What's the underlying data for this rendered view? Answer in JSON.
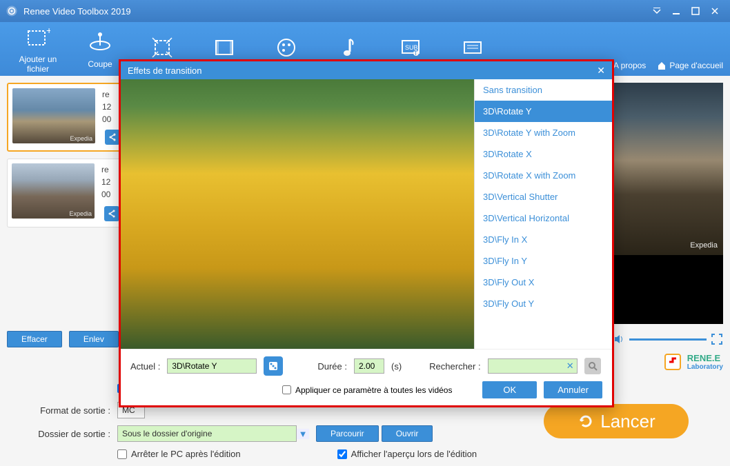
{
  "app": {
    "title": "Renee Video Toolbox 2019"
  },
  "toolbar": {
    "items": [
      {
        "label": "Ajouter un fichier"
      },
      {
        "label": "Coupe"
      },
      {
        "label": ""
      },
      {
        "label": ""
      },
      {
        "label": ""
      },
      {
        "label": ""
      },
      {
        "label": ""
      },
      {
        "label": ""
      }
    ],
    "about": "A propos",
    "home": "Page d'accueil"
  },
  "files": [
    {
      "name_prefix": "re",
      "line2": "12",
      "line3": "00",
      "watermark": "Expedia"
    },
    {
      "name_prefix": "re",
      "line2": "12",
      "line3": "00",
      "watermark": "Expedia"
    }
  ],
  "leftbtns": {
    "effacer": "Effacer",
    "enlever": "Enlev"
  },
  "settings": {
    "format_label": "Format de sortie :",
    "format_value": "MC",
    "folder_label": "Dossier de sortie :",
    "folder_value": "Sous le dossier d'origine",
    "browse": "Parcourir",
    "open": "Ouvrir",
    "stop_pc": "Arrêter le PC après l'édition",
    "show_preview": "Afficher l'aperçu lors de l'édition"
  },
  "launch": "Lancer",
  "brand": {
    "name": "RENE.E",
    "sub": "Laboratory"
  },
  "preview_watermark": "Expedia",
  "modal": {
    "title": "Effets de transition",
    "transitions": [
      "Sans transition",
      "3D\\Rotate Y",
      "3D\\Rotate Y with Zoom",
      "3D\\Rotate X",
      "3D\\Rotate X with Zoom",
      "3D\\Vertical Shutter",
      "3D\\Vertical Horizontal",
      "3D\\Fly In X",
      "3D\\Fly In Y",
      "3D\\Fly Out X",
      "3D\\Fly Out Y"
    ],
    "selected_index": 1,
    "actuel_label": "Actuel :",
    "actuel_value": "3D\\Rotate Y",
    "duree_label": "Durée :",
    "duree_value": "2.00",
    "duree_unit": "(s)",
    "search_label": "Rechercher :",
    "apply_all": "Appliquer ce paramètre à toutes les vidéos",
    "ok": "OK",
    "cancel": "Annuler"
  }
}
